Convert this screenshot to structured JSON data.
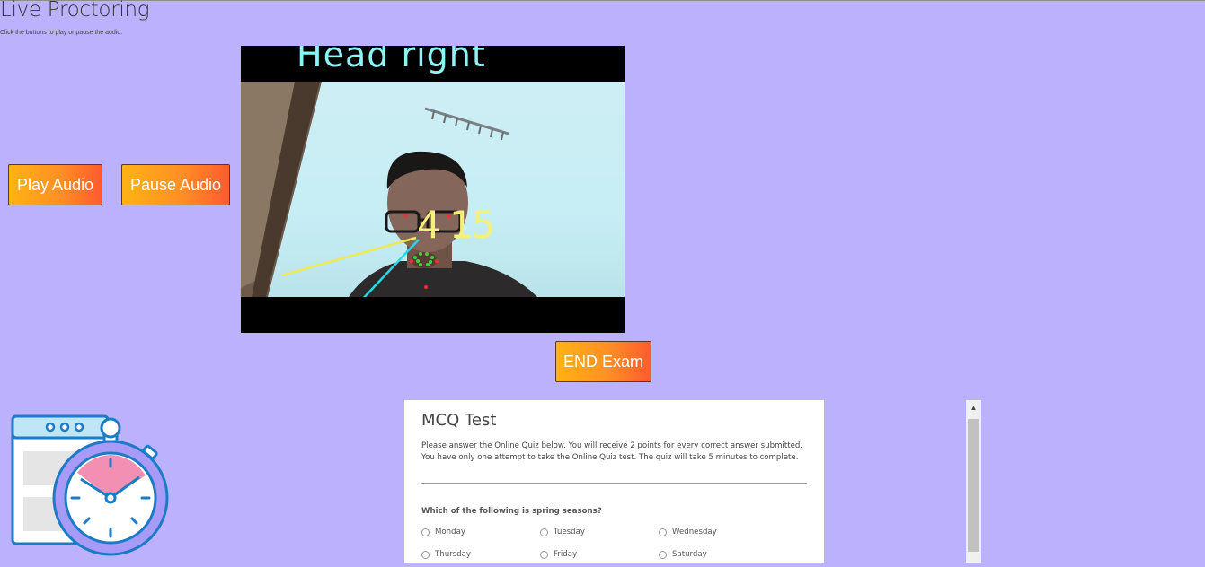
{
  "page": {
    "title": "Live Proctoring",
    "subtitle": "Click the buttons to play or pause the audio."
  },
  "controls": {
    "play_label": "Play Audio",
    "pause_label": "Pause Audio",
    "end_label": "END Exam"
  },
  "camera": {
    "head_status": "Head right",
    "angle_readout": "4 15"
  },
  "quiz": {
    "title": "MCQ Test",
    "description": "Please answer the Online Quiz below. You will receive 2 points for every correct answer submitted. You have only one attempt to take the Online Quiz test. The quiz will take 5 minutes to complete.",
    "question": "Which of the following is spring seasons?",
    "options": [
      "Monday",
      "Tuesday",
      "Wednesday",
      "Thursday",
      "Friday",
      "Saturday"
    ]
  },
  "icons": {
    "timer_illustration": "stopwatch-icon",
    "scroll_up": "arrow-up-icon"
  },
  "colors": {
    "background": "#bcb1fd",
    "button_gradient_start": "#ffb313",
    "button_gradient_end": "#ff5b2d",
    "head_status_text": "#8cf4f4",
    "angle_text": "#f4f07a"
  }
}
